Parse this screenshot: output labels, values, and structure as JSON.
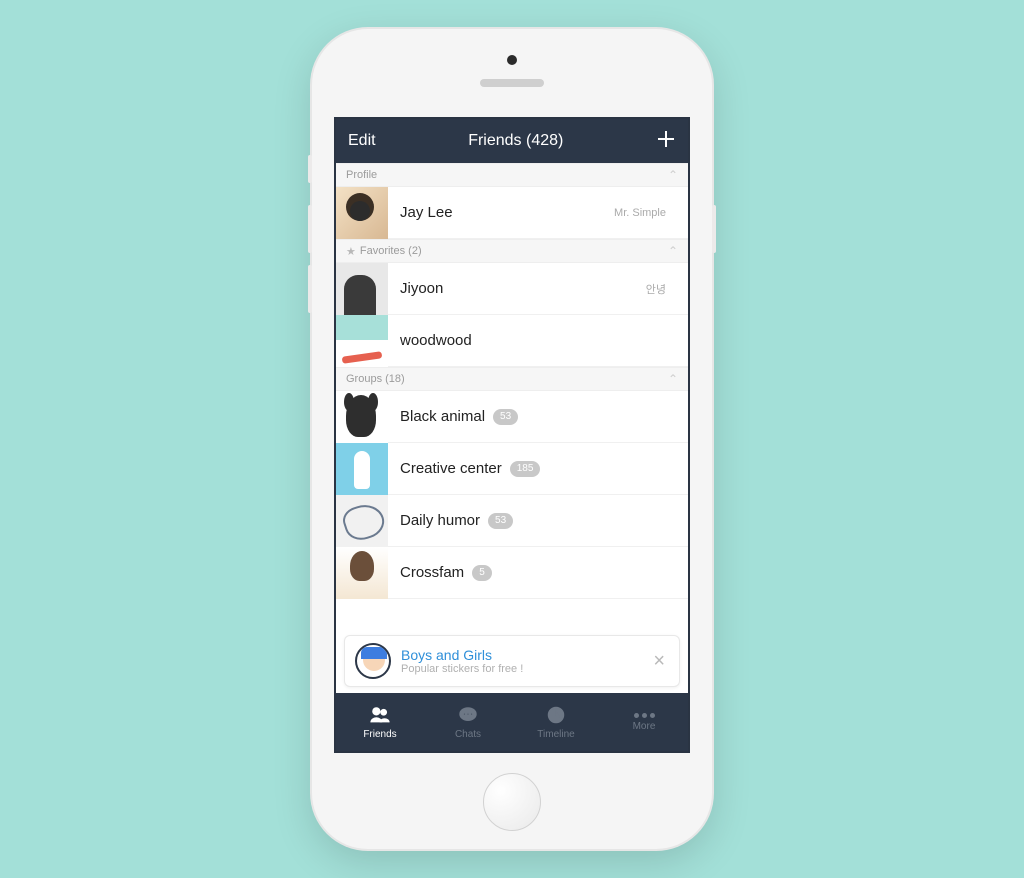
{
  "header": {
    "edit": "Edit",
    "title": "Friends (428)",
    "add": "+"
  },
  "sections": {
    "profile": {
      "label": "Profile"
    },
    "favorites": {
      "label": "Favorites (2)"
    },
    "groups": {
      "label": "Groups (18)"
    }
  },
  "profile": {
    "name": "Jay Lee",
    "status": "Mr. Simple"
  },
  "favorites": [
    {
      "name": "Jiyoon",
      "status": "안녕"
    },
    {
      "name": "woodwood",
      "status": ""
    }
  ],
  "groups": [
    {
      "name": "Black animal",
      "count": "53"
    },
    {
      "name": "Creative center",
      "count": "185"
    },
    {
      "name": "Daily humor",
      "count": "53"
    },
    {
      "name": "Crossfam",
      "count": "5"
    }
  ],
  "promo": {
    "title": "Boys and Girls",
    "subtitle": "Popular stickers for free !"
  },
  "tabs": {
    "friends": "Friends",
    "chats": "Chats",
    "timeline": "Timeline",
    "more": "More"
  }
}
